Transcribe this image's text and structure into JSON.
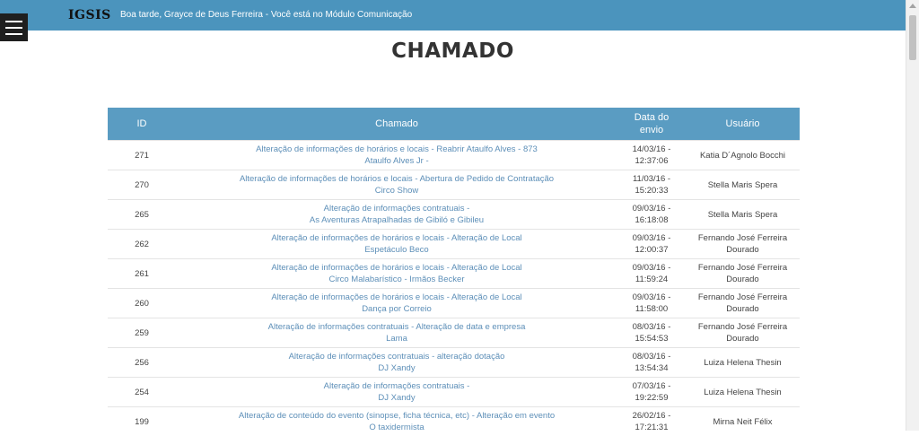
{
  "header": {
    "brand": "IGSIS",
    "greeting": "Boa tarde, Grayce de Deus Ferreira - Você está no Módulo Comunicação"
  },
  "page": {
    "title": "CHAMADO"
  },
  "table": {
    "columns": [
      "ID",
      "Chamado",
      "Data do envio",
      "Usuário"
    ],
    "rows": [
      {
        "id": "271",
        "chamado_line1": "Alteração de informações de horários e locais - Reabrir Ataulfo Alves - 873",
        "chamado_line2": "Ataulfo Alves Jr -",
        "date_line1": "14/03/16 -",
        "date_line2": "12:37:06",
        "user_line1": "Katia D´Agnolo Bocchi",
        "user_line2": ""
      },
      {
        "id": "270",
        "chamado_line1": "Alteração de informações de horários e locais - Abertura de Pedido de Contratação",
        "chamado_line2": "Circo Show",
        "date_line1": "11/03/16 -",
        "date_line2": "15:20:33",
        "user_line1": "Stella Maris Spera",
        "user_line2": ""
      },
      {
        "id": "265",
        "chamado_line1": "Alteração de informações contratuais -",
        "chamado_line2": "As Aventuras Atrapalhadas de Gibiló e Gibileu",
        "date_line1": "09/03/16 -",
        "date_line2": "16:18:08",
        "user_line1": "Stella Maris Spera",
        "user_line2": ""
      },
      {
        "id": "262",
        "chamado_line1": "Alteração de informações de horários e locais - Alteração de Local",
        "chamado_line2": "Espetáculo Beco",
        "date_line1": "09/03/16 -",
        "date_line2": "12:00:37",
        "user_line1": "Fernando José Ferreira",
        "user_line2": "Dourado"
      },
      {
        "id": "261",
        "chamado_line1": "Alteração de informações de horários e locais - Alteração de Local",
        "chamado_line2": "Circo Malabarístico - Irmãos Becker",
        "date_line1": "09/03/16 -",
        "date_line2": "11:59:24",
        "user_line1": "Fernando José Ferreira",
        "user_line2": "Dourado"
      },
      {
        "id": "260",
        "chamado_line1": "Alteração de informações de horários e locais - Alteração de Local",
        "chamado_line2": "Dança por Correio",
        "date_line1": "09/03/16 -",
        "date_line2": "11:58:00",
        "user_line1": "Fernando José Ferreira",
        "user_line2": "Dourado"
      },
      {
        "id": "259",
        "chamado_line1": "Alteração de informações contratuais - Alteração de data e empresa",
        "chamado_line2": "Lama",
        "date_line1": "08/03/16 -",
        "date_line2": "15:54:53",
        "user_line1": "Fernando José Ferreira",
        "user_line2": "Dourado"
      },
      {
        "id": "256",
        "chamado_line1": "Alteração de informações contratuais - alteração dotação",
        "chamado_line2": "DJ Xandy",
        "date_line1": "08/03/16 -",
        "date_line2": "13:54:34",
        "user_line1": "Luiza Helena Thesin",
        "user_line2": ""
      },
      {
        "id": "254",
        "chamado_line1": "Alteração de informações contratuais -",
        "chamado_line2": "DJ Xandy",
        "date_line1": "07/03/16 -",
        "date_line2": "19:22:59",
        "user_line1": "Luiza Helena Thesin",
        "user_line2": ""
      },
      {
        "id": "199",
        "chamado_line1": "Alteração de conteúdo do evento (sinopse, ficha técnica, etc) - Alteração em evento",
        "chamado_line2": "O taxidermista",
        "date_line1": "26/02/16 -",
        "date_line2": "17:21:31",
        "user_line1": "Mirna Neit Félix",
        "user_line2": ""
      }
    ]
  },
  "colors": {
    "header_bg": "#4b94bd",
    "table_header_bg": "#5a9cc2",
    "link": "#5d8fb8"
  },
  "icons": {
    "menu": "hamburger-menu-icon"
  }
}
